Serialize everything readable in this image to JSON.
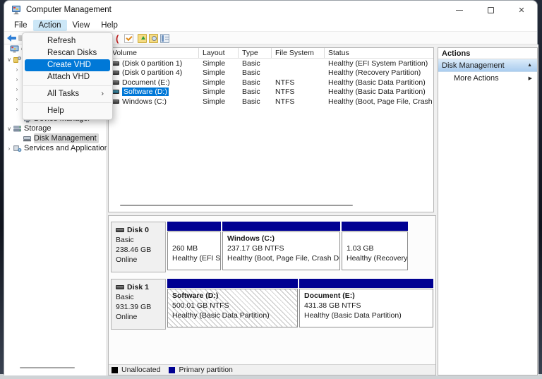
{
  "window": {
    "title": "Computer Management"
  },
  "icons": {
    "close": "✕",
    "chevron_down": "∨",
    "chevron_right": "›",
    "submenu_arrow": "›",
    "actions_collapse": "▲",
    "more_actions_arrow": "▶"
  },
  "menubar": {
    "items": [
      {
        "label": "File",
        "active": false
      },
      {
        "label": "Action",
        "active": true
      },
      {
        "label": "View",
        "active": false
      },
      {
        "label": "Help",
        "active": false
      }
    ]
  },
  "action_menu": {
    "items": [
      {
        "label": "Refresh",
        "highlighted": false
      },
      {
        "label": "Rescan Disks",
        "highlighted": false
      },
      {
        "label": "Create VHD",
        "highlighted": true
      },
      {
        "label": "Attach VHD",
        "highlighted": false
      },
      {
        "label": "All Tasks",
        "highlighted": false,
        "has_submenu": true
      },
      {
        "label": "Help",
        "highlighted": false
      }
    ]
  },
  "tree": {
    "items": [
      {
        "label": "Computer Management",
        "level": 0
      },
      {
        "label": "",
        "level": 1,
        "expanded": true
      },
      {
        "label": "",
        "level": 2
      },
      {
        "label": "",
        "level": 2
      },
      {
        "label": "",
        "level": 2
      },
      {
        "label": "",
        "level": 2
      },
      {
        "label": "",
        "level": 2
      },
      {
        "label": "Device Manager",
        "level": 2
      },
      {
        "label": "Storage",
        "level": 1,
        "expanded": true
      },
      {
        "label": "Disk Management",
        "level": 2,
        "selected": true
      },
      {
        "label": "Services and Applications",
        "level": 1
      }
    ]
  },
  "volume_list": {
    "columns": [
      "Volume",
      "Layout",
      "Type",
      "File System",
      "Status"
    ],
    "rows": [
      {
        "volume": "(Disk 0 partition 1)",
        "layout": "Simple",
        "type": "Basic",
        "fs": "",
        "status": "Healthy (EFI System Partition)",
        "selected": false
      },
      {
        "volume": "(Disk 0 partition 4)",
        "layout": "Simple",
        "type": "Basic",
        "fs": "",
        "status": "Healthy (Recovery Partition)",
        "selected": false
      },
      {
        "volume": "Document (E:)",
        "layout": "Simple",
        "type": "Basic",
        "fs": "NTFS",
        "status": "Healthy (Basic Data Partition)",
        "selected": false
      },
      {
        "volume": "Software (D:)",
        "layout": "Simple",
        "type": "Basic",
        "fs": "NTFS",
        "status": "Healthy (Basic Data Partition)",
        "selected": true
      },
      {
        "volume": "Windows (C:)",
        "layout": "Simple",
        "type": "Basic",
        "fs": "NTFS",
        "status": "Healthy (Boot, Page File, Crash Dump, Basic Data Partition)",
        "selected": false
      }
    ]
  },
  "disks": [
    {
      "name": "Disk 0",
      "type": "Basic",
      "size": "238.46 GB",
      "status": "Online",
      "partitions": [
        {
          "title": "",
          "line1": "260 MB",
          "line2": "Healthy (EFI Sys",
          "line3": "",
          "selected": false
        },
        {
          "title": "Windows  (C:)",
          "line1": "237.17 GB NTFS",
          "line2": "Healthy (Boot, Page File, Crash Dump,",
          "line3": "",
          "selected": false
        },
        {
          "title": "",
          "line1": "1.03 GB",
          "line2": "Healthy (Recovery P",
          "line3": "",
          "selected": false
        }
      ]
    },
    {
      "name": "Disk 1",
      "type": "Basic",
      "size": "931.39 GB",
      "status": "Online",
      "partitions": [
        {
          "title": "Software  (D:)",
          "line1": "500.01 GB NTFS",
          "line2": "Healthy (Basic Data Partition)",
          "line3": "",
          "selected": true
        },
        {
          "title": "Document  (E:)",
          "line1": "431.38 GB NTFS",
          "line2": "Healthy (Basic Data Partition)",
          "line3": "",
          "selected": false
        }
      ]
    }
  ],
  "legend": [
    {
      "label": "Unallocated",
      "color": "#000000"
    },
    {
      "label": "Primary partition",
      "color": "#000092"
    }
  ],
  "actions": {
    "header": "Actions",
    "section": "Disk Management",
    "items": [
      "More Actions"
    ]
  },
  "colors": {
    "accent_selection": "#0078d7",
    "menubar_active": "#cce7f7",
    "partition_bar": "#000092",
    "tree_selection": "#d6d6d6",
    "actions_gradient_top": "#dcecfa",
    "actions_gradient_bottom": "#aacdf0"
  }
}
